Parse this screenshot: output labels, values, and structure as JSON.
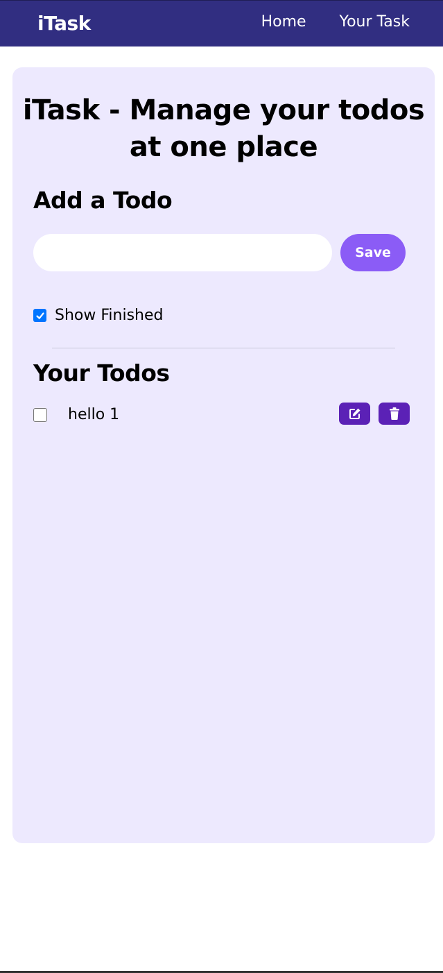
{
  "navbar": {
    "brand": "iTask",
    "links": [
      {
        "label": "Home"
      },
      {
        "label": "Your Task"
      }
    ],
    "background_color": "#312e81"
  },
  "main": {
    "title": "iTask - Manage your todos at one place",
    "add_section": {
      "title": "Add a Todo",
      "input_value": "",
      "save_label": "Save",
      "save_color": "#8b5cf6"
    },
    "show_finished": {
      "label": "Show Finished",
      "checked": true
    },
    "todos_section": {
      "title": "Your Todos",
      "items": [
        {
          "text": "hello 1",
          "completed": false,
          "edit_icon": "edit-icon",
          "delete_icon": "trash-icon"
        }
      ],
      "action_color": "#5b21b6"
    },
    "card_background": "#ede9fe"
  }
}
